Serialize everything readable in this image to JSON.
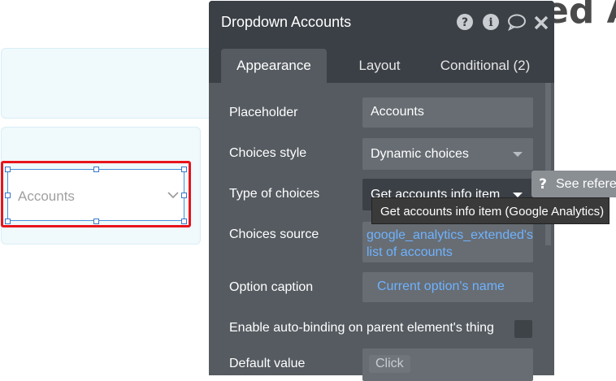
{
  "canvas": {
    "background_title": "ed A",
    "selected_element": {
      "text": "Accounts"
    }
  },
  "panel": {
    "title": "Dropdown Accounts",
    "header_icons": [
      "help-circle-icon",
      "info-circle-icon",
      "comment-icon",
      "close-icon"
    ],
    "tabs": [
      {
        "label": "Appearance",
        "active": true
      },
      {
        "label": "Layout",
        "active": false
      },
      {
        "label": "Conditional (2)",
        "active": false
      }
    ],
    "fields": {
      "placeholder": {
        "label": "Placeholder",
        "value": "Accounts"
      },
      "choices_style": {
        "label": "Choices style",
        "value": "Dynamic choices"
      },
      "type_of_choices": {
        "label": "Type of choices",
        "value": "Get accounts info item"
      },
      "choices_source": {
        "label": "Choices source",
        "line1": "google_analytics_extended's",
        "line2": "list of accounts"
      },
      "option_caption": {
        "label": "Option caption",
        "value": "Current option's name"
      },
      "auto_binding": {
        "label": "Enable auto-binding on parent element's thing"
      },
      "default_value": {
        "label": "Default value",
        "value": "Click"
      }
    }
  },
  "tooltip": {
    "text": "Get accounts info item (Google Analytics)"
  },
  "see_reference": {
    "label": "See refere"
  },
  "colors": {
    "accent_link": "#6fb2ff",
    "selection_outline": "#e8141a",
    "panel_bg": "#555b61",
    "header_bg": "#3b4046"
  }
}
